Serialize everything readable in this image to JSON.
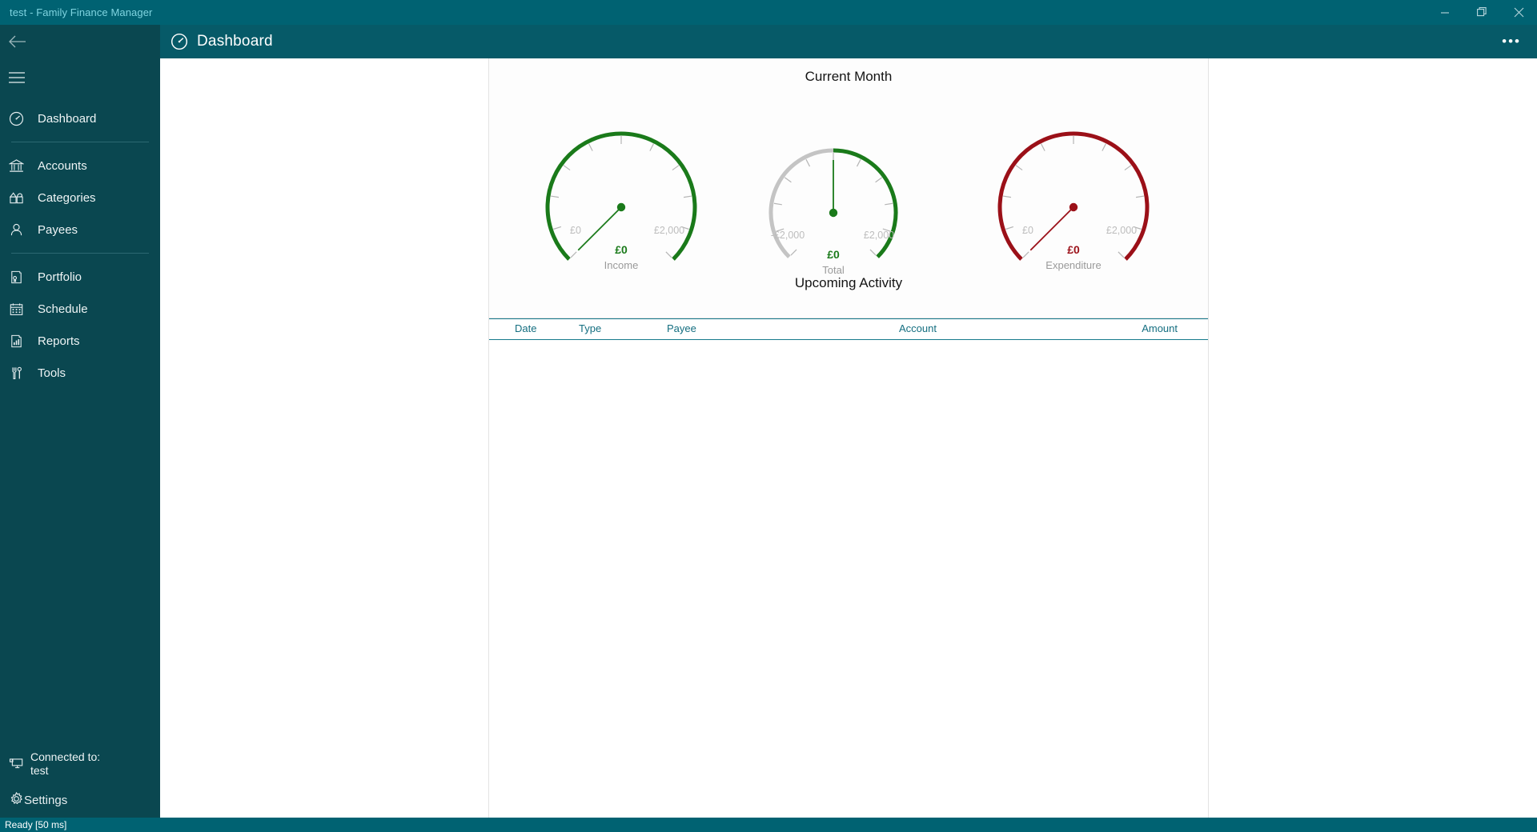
{
  "window": {
    "title": "test - Family Finance Manager",
    "controls": [
      {
        "name": "minimize",
        "glyph": "minimize-icon"
      },
      {
        "name": "restore",
        "glyph": "restore-icon"
      },
      {
        "name": "close",
        "glyph": "close-icon"
      }
    ]
  },
  "header": {
    "icon": "dashboard-gauge-icon",
    "title": "Dashboard",
    "more_label": "•••"
  },
  "sidebar": {
    "back_icon": "back-arrow-icon",
    "menu_icon": "hamburger-menu-icon",
    "items": [
      {
        "label": "Dashboard",
        "icon": "gauge-icon"
      },
      {
        "label": "Accounts",
        "icon": "bank-icon"
      },
      {
        "label": "Categories",
        "icon": "categories-icon"
      },
      {
        "label": "Payees",
        "icon": "person-icon"
      },
      {
        "label": "Portfolio",
        "icon": "certificate-icon"
      },
      {
        "label": "Schedule",
        "icon": "calendar-icon"
      },
      {
        "label": "Reports",
        "icon": "report-chart-icon"
      },
      {
        "label": "Tools",
        "icon": "tools-icon"
      }
    ],
    "connection": {
      "icon": "connected-monitor-icon",
      "line1": "Connected to:",
      "line2": "test"
    },
    "settings": {
      "label": "Settings",
      "icon": "gear-icon"
    }
  },
  "main": {
    "current_month_title": "Current Month",
    "upcoming_title": "Upcoming Activity",
    "table": {
      "columns": [
        "Date",
        "Type",
        "Payee",
        "Account",
        "Amount"
      ],
      "rows": []
    }
  },
  "chart_data": [
    {
      "type": "gauge",
      "title": "Income",
      "value": 0,
      "value_label": "£0",
      "min": 0,
      "max": 2000,
      "min_label": "£0",
      "max_label": "£2,000",
      "arc_color": "#1a7a1a",
      "value_color": "#1a7a1a",
      "needle_angle_deg": -135,
      "arc_start_deg": -135,
      "arc_end_deg": 135,
      "ticks": 11
    },
    {
      "type": "gauge",
      "title": "Total",
      "value": 0,
      "value_label": "£0",
      "min": -2000,
      "max": 2000,
      "min_label": "-£2,000",
      "max_label": "£2,000",
      "arc_color": "#1a7a1a",
      "arc_negative_color": "#c4c4c4",
      "value_color": "#1a7a1a",
      "needle_angle_deg": 0,
      "arc_start_deg": -135,
      "arc_end_deg": 135,
      "ticks": 11
    },
    {
      "type": "gauge",
      "title": "Expenditure",
      "value": 0,
      "value_label": "£0",
      "min": 0,
      "max": 2000,
      "min_label": "£0",
      "max_label": "£2,000",
      "arc_color": "#9b1018",
      "value_color": "#9b1018",
      "needle_angle_deg": -135,
      "arc_start_deg": -135,
      "arc_end_deg": 135,
      "ticks": 11
    }
  ],
  "statusbar": {
    "text": "Ready [50 ms]"
  },
  "colors": {
    "titlebar": "#006272",
    "header": "#065a68",
    "sidebar": "#0a4750",
    "accent_teal": "#146e80",
    "income_green": "#1a7a1a",
    "expenditure_red": "#9b1018",
    "neutral_gray": "#c4c4c4"
  }
}
